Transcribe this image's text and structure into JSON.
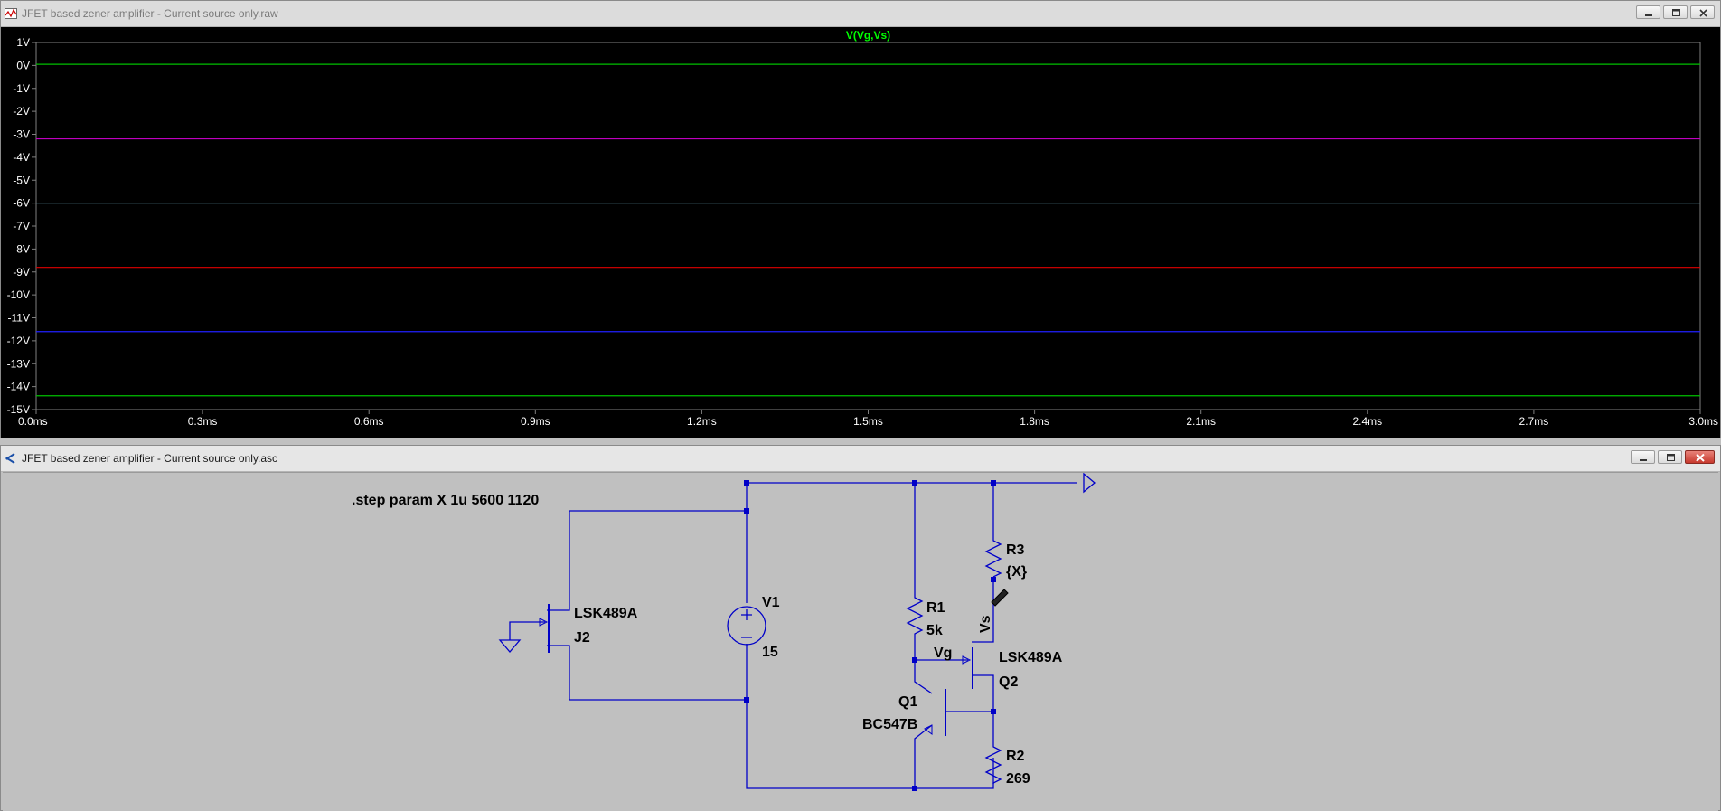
{
  "plot_window": {
    "title": "JFET based zener amplifier - Current source only.raw",
    "trace_label": "V(Vg,Vs)",
    "trace_label_color": "#00ff00"
  },
  "schematic_window": {
    "title": "JFET based zener amplifier - Current source only.asc",
    "directive": ".step param X 1u 5600 1120",
    "components": {
      "V1": {
        "name": "V1",
        "value": "15"
      },
      "J2": {
        "name": "J2",
        "model": "LSK489A"
      },
      "R1": {
        "name": "R1",
        "value": "5k"
      },
      "R2": {
        "name": "R2",
        "value": "269"
      },
      "R3": {
        "name": "R3",
        "value": "{X}"
      },
      "Q1": {
        "name": "Q1",
        "model": "BC547B"
      },
      "Q2": {
        "name": "Q2",
        "model": "LSK489A"
      }
    },
    "net_labels": {
      "vg": "Vg",
      "vs": "Vs"
    },
    "wire_color": "#0000c8"
  },
  "window_buttons": {
    "minimize": "minimize-icon",
    "restore": "restore-icon",
    "close": "close-icon"
  },
  "chart_data": {
    "type": "line",
    "title": "V(Vg,Vs)",
    "xlabel": "",
    "ylabel": "",
    "x_ticks": [
      "0.0ms",
      "0.3ms",
      "0.6ms",
      "0.9ms",
      "1.2ms",
      "1.5ms",
      "1.8ms",
      "2.1ms",
      "2.4ms",
      "2.7ms",
      "3.0ms"
    ],
    "y_ticks": [
      "1V",
      "0V",
      "-1V",
      "-2V",
      "-3V",
      "-4V",
      "-5V",
      "-6V",
      "-7V",
      "-8V",
      "-9V",
      "-10V",
      "-11V",
      "-12V",
      "-13V",
      "-14V",
      "-15V"
    ],
    "xlim": [
      0,
      3.0
    ],
    "ylim": [
      -15,
      1
    ],
    "grid": false,
    "background": "#000000",
    "series": [
      {
        "color": "#00c000",
        "x": [
          0,
          3.0
        ],
        "y": [
          0.05,
          0.05
        ]
      },
      {
        "color": "#c000c0",
        "x": [
          0,
          3.0
        ],
        "y": [
          -3.2,
          -3.2
        ]
      },
      {
        "color": "#5a8a9a",
        "x": [
          0,
          3.0
        ],
        "y": [
          -6.0,
          -6.0
        ]
      },
      {
        "color": "#e00000",
        "x": [
          0,
          3.0
        ],
        "y": [
          -8.8,
          -8.8
        ]
      },
      {
        "color": "#2020ff",
        "x": [
          0,
          3.0
        ],
        "y": [
          -11.6,
          -11.6
        ]
      },
      {
        "color": "#00c000",
        "x": [
          0,
          3.0
        ],
        "y": [
          -14.4,
          -14.4
        ]
      }
    ]
  }
}
